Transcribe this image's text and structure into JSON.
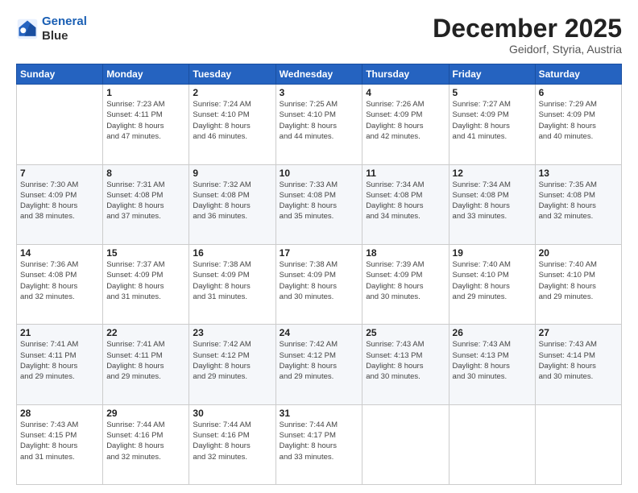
{
  "header": {
    "logo_line1": "General",
    "logo_line2": "Blue",
    "month": "December 2025",
    "location": "Geidorf, Styria, Austria"
  },
  "weekdays": [
    "Sunday",
    "Monday",
    "Tuesday",
    "Wednesday",
    "Thursday",
    "Friday",
    "Saturday"
  ],
  "weeks": [
    [
      {
        "day": "",
        "info": ""
      },
      {
        "day": "1",
        "info": "Sunrise: 7:23 AM\nSunset: 4:11 PM\nDaylight: 8 hours\nand 47 minutes."
      },
      {
        "day": "2",
        "info": "Sunrise: 7:24 AM\nSunset: 4:10 PM\nDaylight: 8 hours\nand 46 minutes."
      },
      {
        "day": "3",
        "info": "Sunrise: 7:25 AM\nSunset: 4:10 PM\nDaylight: 8 hours\nand 44 minutes."
      },
      {
        "day": "4",
        "info": "Sunrise: 7:26 AM\nSunset: 4:09 PM\nDaylight: 8 hours\nand 42 minutes."
      },
      {
        "day": "5",
        "info": "Sunrise: 7:27 AM\nSunset: 4:09 PM\nDaylight: 8 hours\nand 41 minutes."
      },
      {
        "day": "6",
        "info": "Sunrise: 7:29 AM\nSunset: 4:09 PM\nDaylight: 8 hours\nand 40 minutes."
      }
    ],
    [
      {
        "day": "7",
        "info": "Sunrise: 7:30 AM\nSunset: 4:09 PM\nDaylight: 8 hours\nand 38 minutes."
      },
      {
        "day": "8",
        "info": "Sunrise: 7:31 AM\nSunset: 4:08 PM\nDaylight: 8 hours\nand 37 minutes."
      },
      {
        "day": "9",
        "info": "Sunrise: 7:32 AM\nSunset: 4:08 PM\nDaylight: 8 hours\nand 36 minutes."
      },
      {
        "day": "10",
        "info": "Sunrise: 7:33 AM\nSunset: 4:08 PM\nDaylight: 8 hours\nand 35 minutes."
      },
      {
        "day": "11",
        "info": "Sunrise: 7:34 AM\nSunset: 4:08 PM\nDaylight: 8 hours\nand 34 minutes."
      },
      {
        "day": "12",
        "info": "Sunrise: 7:34 AM\nSunset: 4:08 PM\nDaylight: 8 hours\nand 33 minutes."
      },
      {
        "day": "13",
        "info": "Sunrise: 7:35 AM\nSunset: 4:08 PM\nDaylight: 8 hours\nand 32 minutes."
      }
    ],
    [
      {
        "day": "14",
        "info": "Sunrise: 7:36 AM\nSunset: 4:08 PM\nDaylight: 8 hours\nand 32 minutes."
      },
      {
        "day": "15",
        "info": "Sunrise: 7:37 AM\nSunset: 4:09 PM\nDaylight: 8 hours\nand 31 minutes."
      },
      {
        "day": "16",
        "info": "Sunrise: 7:38 AM\nSunset: 4:09 PM\nDaylight: 8 hours\nand 31 minutes."
      },
      {
        "day": "17",
        "info": "Sunrise: 7:38 AM\nSunset: 4:09 PM\nDaylight: 8 hours\nand 30 minutes."
      },
      {
        "day": "18",
        "info": "Sunrise: 7:39 AM\nSunset: 4:09 PM\nDaylight: 8 hours\nand 30 minutes."
      },
      {
        "day": "19",
        "info": "Sunrise: 7:40 AM\nSunset: 4:10 PM\nDaylight: 8 hours\nand 29 minutes."
      },
      {
        "day": "20",
        "info": "Sunrise: 7:40 AM\nSunset: 4:10 PM\nDaylight: 8 hours\nand 29 minutes."
      }
    ],
    [
      {
        "day": "21",
        "info": "Sunrise: 7:41 AM\nSunset: 4:11 PM\nDaylight: 8 hours\nand 29 minutes."
      },
      {
        "day": "22",
        "info": "Sunrise: 7:41 AM\nSunset: 4:11 PM\nDaylight: 8 hours\nand 29 minutes."
      },
      {
        "day": "23",
        "info": "Sunrise: 7:42 AM\nSunset: 4:12 PM\nDaylight: 8 hours\nand 29 minutes."
      },
      {
        "day": "24",
        "info": "Sunrise: 7:42 AM\nSunset: 4:12 PM\nDaylight: 8 hours\nand 29 minutes."
      },
      {
        "day": "25",
        "info": "Sunrise: 7:43 AM\nSunset: 4:13 PM\nDaylight: 8 hours\nand 30 minutes."
      },
      {
        "day": "26",
        "info": "Sunrise: 7:43 AM\nSunset: 4:13 PM\nDaylight: 8 hours\nand 30 minutes."
      },
      {
        "day": "27",
        "info": "Sunrise: 7:43 AM\nSunset: 4:14 PM\nDaylight: 8 hours\nand 30 minutes."
      }
    ],
    [
      {
        "day": "28",
        "info": "Sunrise: 7:43 AM\nSunset: 4:15 PM\nDaylight: 8 hours\nand 31 minutes."
      },
      {
        "day": "29",
        "info": "Sunrise: 7:44 AM\nSunset: 4:16 PM\nDaylight: 8 hours\nand 32 minutes."
      },
      {
        "day": "30",
        "info": "Sunrise: 7:44 AM\nSunset: 4:16 PM\nDaylight: 8 hours\nand 32 minutes."
      },
      {
        "day": "31",
        "info": "Sunrise: 7:44 AM\nSunset: 4:17 PM\nDaylight: 8 hours\nand 33 minutes."
      },
      {
        "day": "",
        "info": ""
      },
      {
        "day": "",
        "info": ""
      },
      {
        "day": "",
        "info": ""
      }
    ]
  ]
}
